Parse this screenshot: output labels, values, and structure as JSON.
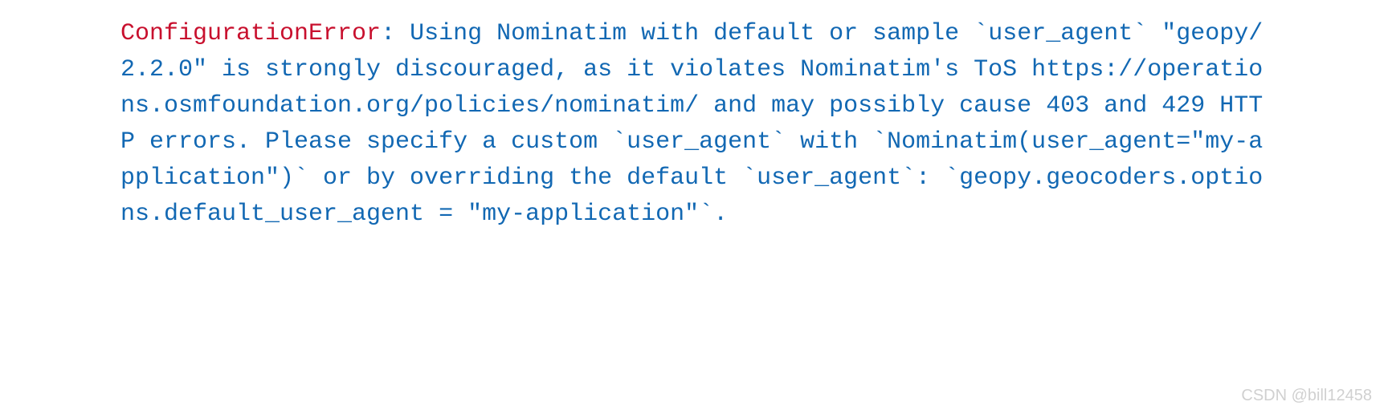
{
  "error": {
    "type": "ConfigurationError",
    "separator": ": ",
    "message": "Using Nominatim with default or sample `user_agent` \"geopy/2.2.0\" is strongly discouraged, as it violates Nominatim's ToS https://operations.osmfoundation.org/policies/nominatim/ and may possibly cause 403 and 429 HTTP errors. Please specify a custom `user_agent` with `Nominatim(user_agent=\"my-application\")` or by overriding the default `user_agent`: `geopy.geocoders.options.default_user_agent = \"my-application\"`."
  },
  "watermark": "CSDN @bill12458"
}
